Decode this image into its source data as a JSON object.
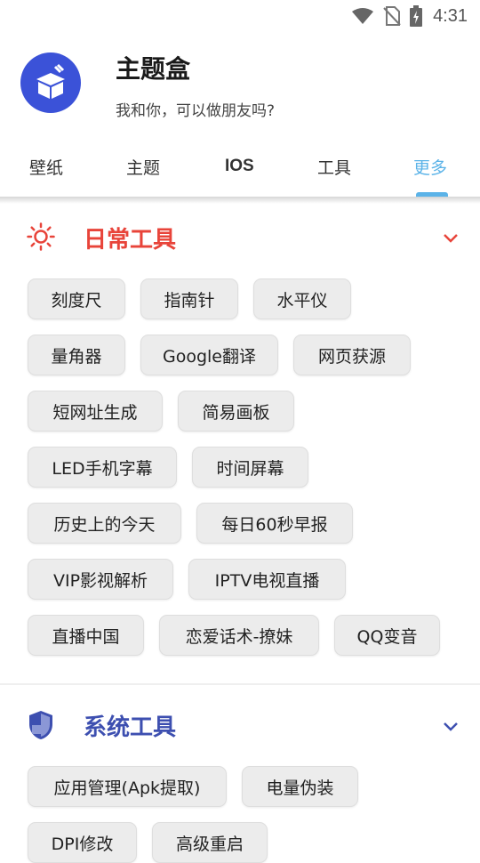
{
  "status_bar": {
    "time": "4:31"
  },
  "app": {
    "title": "主题盒",
    "subtitle": "我和你，可以做朋友吗?"
  },
  "tabs": [
    {
      "label": "壁纸"
    },
    {
      "label": "主题"
    },
    {
      "label": "IOS"
    },
    {
      "label": "工具"
    },
    {
      "label": "更多",
      "active": true
    }
  ],
  "sections": [
    {
      "title": "日常工具",
      "color": "#e8443a",
      "icon": "sun-icon",
      "items": [
        "刻度尺",
        "指南针",
        "水平仪",
        "量角器",
        "Google翻译",
        "网页获源",
        "短网址生成",
        "简易画板",
        "LED手机字幕",
        "时间屏幕",
        "历史上的今天",
        "每日60秒早报",
        "VIP影视解析",
        "IPTV电视直播",
        "直播中国",
        "恋爱话术-撩妹",
        "QQ变音"
      ]
    },
    {
      "title": "系统工具",
      "color": "#3d4fb0",
      "icon": "shield-icon",
      "items": [
        "应用管理(Apk提取)",
        "电量伪装",
        "DPI修改",
        "高级重启"
      ]
    }
  ]
}
